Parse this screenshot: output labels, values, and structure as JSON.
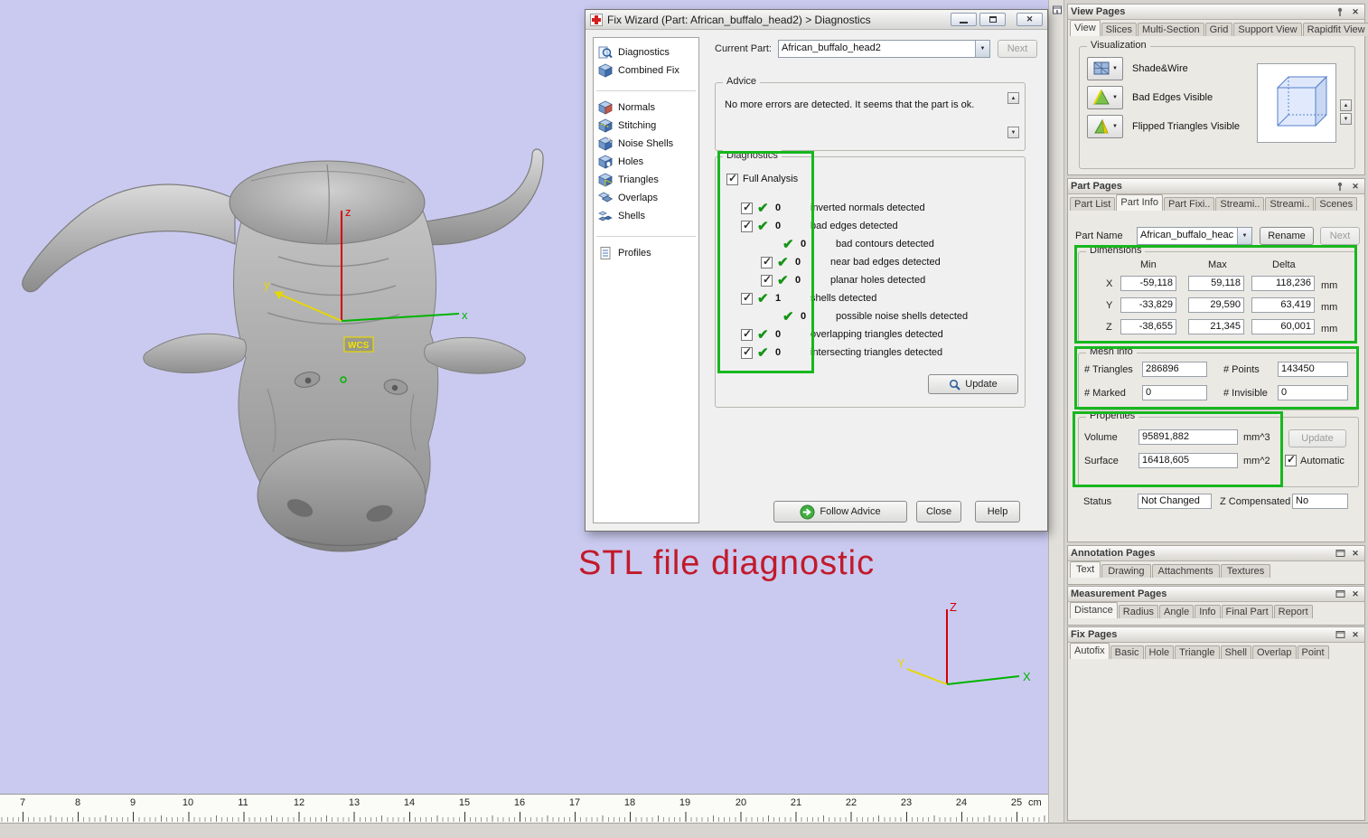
{
  "colors": {
    "viewport_bg": "#cacaf0",
    "annotation_green": "#17b71e",
    "caption_red": "#c11a2b",
    "axis_x": "#00b400",
    "axis_y": "#e6d800",
    "axis_z": "#d40000"
  },
  "icons": {
    "close_glyph": "✕",
    "dropdown_glyph": "▼",
    "up_glyph": "▲",
    "down_glyph": "▼",
    "check_glyph": "✓",
    "ok_glyph": "✔"
  },
  "viewport": {
    "caption": "STL file diagnostic",
    "wcs_label": "WCS",
    "axes": {
      "x": "x",
      "y": "y",
      "z": "z"
    },
    "triad": {
      "x": "X",
      "y": "Y",
      "z": "Z"
    }
  },
  "ruler": {
    "numbers": [
      "7",
      "8",
      "9",
      "10",
      "11",
      "12",
      "13",
      "14",
      "15",
      "16",
      "17",
      "18",
      "19",
      "20",
      "21",
      "22",
      "23",
      "24",
      "25"
    ],
    "unit": "cm"
  },
  "fix_wizard": {
    "title": "Fix Wizard (Part: African_buffalo_head2) > Diagnostics",
    "nav": {
      "diagnostics": "Diagnostics",
      "combined_fix": "Combined Fix",
      "normals": "Normals",
      "stitching": "Stitching",
      "noise_shells": "Noise Shells",
      "holes": "Holes",
      "triangles": "Triangles",
      "overlaps": "Overlaps",
      "shells": "Shells",
      "profiles": "Profiles"
    },
    "current_part_label": "Current Part:",
    "current_part_value": "African_buffalo_head2",
    "next_label": "Next",
    "advice": {
      "title": "Advice",
      "text": "No more errors are detected. It seems that the part is ok."
    },
    "diagnostics": {
      "title": "Diagnostics",
      "full_analysis_label": "Full Analysis",
      "rows": [
        {
          "count": "0",
          "label": "inverted normals detected"
        },
        {
          "count": "0",
          "label": "bad edges detected"
        },
        {
          "count": "0",
          "label": "bad contours detected"
        },
        {
          "count": "0",
          "label": "near bad edges detected"
        },
        {
          "count": "0",
          "label": "planar holes detected"
        },
        {
          "count": "1",
          "label": "shells detected"
        },
        {
          "count": "0",
          "label": "possible noise shells detected"
        },
        {
          "count": "0",
          "label": "overlapping triangles detected"
        },
        {
          "count": "0",
          "label": "intersecting triangles detected"
        }
      ],
      "update_label": "Update"
    },
    "footer": {
      "follow_advice": "Follow Advice",
      "close": "Close",
      "help": "Help"
    }
  },
  "view_pages": {
    "title": "View Pages",
    "tabs": [
      "View",
      "Slices",
      "Multi-Section",
      "Grid",
      "Support View",
      "Rapidfit View"
    ],
    "visualization": {
      "title": "Visualization",
      "shade_wire": "Shade&Wire",
      "bad_edges": "Bad Edges Visible",
      "flipped_triangles": "Flipped Triangles Visible"
    }
  },
  "part_pages": {
    "title": "Part Pages",
    "tabs": [
      "Part List",
      "Part Info",
      "Part Fixi..",
      "Streami..",
      "Streami..",
      "Scenes"
    ],
    "part_name_label": "Part Name",
    "part_name_value": "African_buffalo_heac",
    "rename_label": "Rename",
    "next_label": "Next",
    "dimensions": {
      "title": "Dimensions",
      "col_min": "Min",
      "col_max": "Max",
      "col_delta": "Delta",
      "unit": "mm",
      "x": {
        "axis": "X",
        "min": "-59,118",
        "max": "59,118",
        "delta": "118,236"
      },
      "y": {
        "axis": "Y",
        "min": "-33,829",
        "max": "29,590",
        "delta": "63,419"
      },
      "z": {
        "axis": "Z",
        "min": "-38,655",
        "max": "21,345",
        "delta": "60,001"
      }
    },
    "mesh_info": {
      "title": "Mesh info",
      "triangles_label": "# Triangles",
      "triangles_value": "286896",
      "points_label": "# Points",
      "points_value": "143450",
      "marked_label": "# Marked",
      "marked_value": "0",
      "invisible_label": "# Invisible",
      "invisible_value": "0"
    },
    "properties": {
      "title": "Properties",
      "volume_label": "Volume",
      "volume_value": "95891,882",
      "volume_unit": "mm^3",
      "surface_label": "Surface",
      "surface_value": "16418,605",
      "surface_unit": "mm^2",
      "update_label": "Update",
      "automatic_label": "Automatic"
    },
    "status_label": "Status",
    "status_value": "Not Changed",
    "z_compensated_label": "Z Compensated",
    "z_compensated_value": "No"
  },
  "annotation_pages": {
    "title": "Annotation Pages",
    "tabs": [
      "Text",
      "Drawing",
      "Attachments",
      "Textures"
    ]
  },
  "measurement_pages": {
    "title": "Measurement Pages",
    "tabs": [
      "Distance",
      "Radius",
      "Angle",
      "Info",
      "Final Part",
      "Report"
    ]
  },
  "fix_pages": {
    "title": "Fix Pages",
    "tabs": [
      "Autofix",
      "Basic",
      "Hole",
      "Triangle",
      "Shell",
      "Overlap",
      "Point"
    ]
  }
}
